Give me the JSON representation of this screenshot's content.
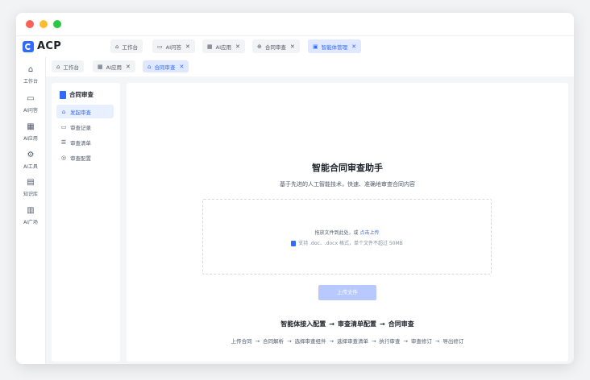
{
  "app": {
    "name": "ACP"
  },
  "window_controls": {
    "colors": [
      "#ff5f57",
      "#febc2e",
      "#28c840"
    ]
  },
  "top_tabs": [
    {
      "label": "工作台",
      "icon": "home-icon",
      "closable": false,
      "active": false
    },
    {
      "label": "AI问答",
      "icon": "chat-icon",
      "closable": true,
      "active": false
    },
    {
      "label": "AI应用",
      "icon": "grid-icon",
      "closable": true,
      "active": false
    },
    {
      "label": "合同审查",
      "icon": "globe-icon",
      "closable": true,
      "active": false
    },
    {
      "label": "智能体管理",
      "icon": "bot-icon",
      "closable": true,
      "active": true
    }
  ],
  "rail": [
    {
      "label": "工作台",
      "icon": "home-icon"
    },
    {
      "label": "AI问答",
      "icon": "chat-icon"
    },
    {
      "label": "AI应用",
      "icon": "grid-icon"
    },
    {
      "label": "AI工具",
      "icon": "tool-icon"
    },
    {
      "label": "知识库",
      "icon": "book-icon"
    },
    {
      "label": "AI广场",
      "icon": "plaza-icon"
    }
  ],
  "sub_tabs": [
    {
      "label": "工作台",
      "icon": "home-icon",
      "closable": false,
      "active": false
    },
    {
      "label": "AI应用",
      "icon": "grid-icon",
      "closable": true,
      "active": false
    },
    {
      "label": "合同审查",
      "icon": "bank-icon",
      "closable": true,
      "active": true
    }
  ],
  "left_nav": {
    "title": "合同审查",
    "items": [
      {
        "label": "发起审查",
        "icon": "bank-icon",
        "active": true
      },
      {
        "label": "审查记录",
        "icon": "record-icon",
        "active": false
      },
      {
        "label": "审查清单",
        "icon": "list-icon",
        "active": false
      },
      {
        "label": "审查配置",
        "icon": "settings-icon",
        "active": false
      }
    ]
  },
  "main": {
    "title": "智能合同审查助手",
    "subtitle": "基于先进的人工智能技术，快速、准确地审查合同内容",
    "drop": {
      "prompt": "拖放文件到此处，或",
      "link": "点击上传",
      "hint": "支持 .doc、.docx 格式，单个文件不超过 50MB"
    },
    "upload_button": "上传文件",
    "flow_main": [
      "智能体接入配置",
      "审查清单配置",
      "合同审查"
    ],
    "flow_steps": [
      "上传合同",
      "合同解析",
      "选择审查组件",
      "选择审查清单",
      "执行审查",
      "审查修订",
      "导出修订"
    ],
    "arrow": "→"
  },
  "colors": {
    "accent": "#2f6bff",
    "accent_light": "#dfe8ff",
    "button_disabled": "#b8c9ff"
  }
}
